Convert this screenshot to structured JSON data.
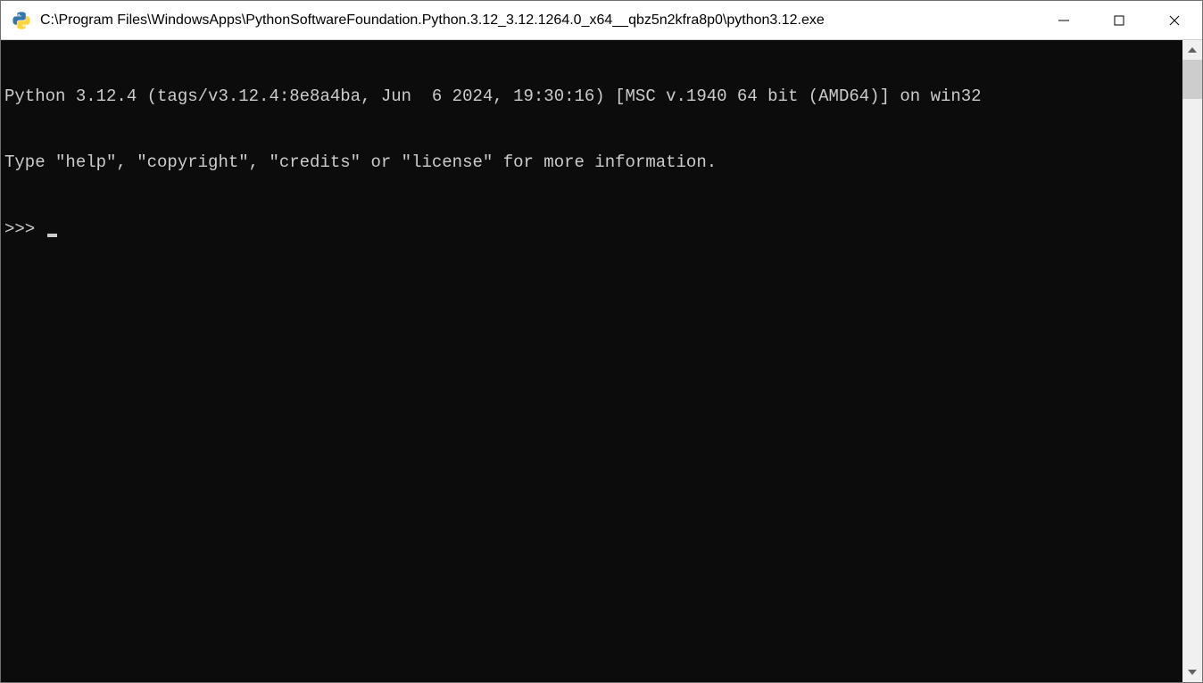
{
  "window": {
    "title": "C:\\Program Files\\WindowsApps\\PythonSoftwareFoundation.Python.3.12_3.12.1264.0_x64__qbz5n2kfra8p0\\python3.12.exe"
  },
  "console": {
    "line1": "Python 3.12.4 (tags/v3.12.4:8e8a4ba, Jun  6 2024, 19:30:16) [MSC v.1940 64 bit (AMD64)] on win32",
    "line2": "Type \"help\", \"copyright\", \"credits\" or \"license\" for more information.",
    "prompt": ">>> "
  }
}
